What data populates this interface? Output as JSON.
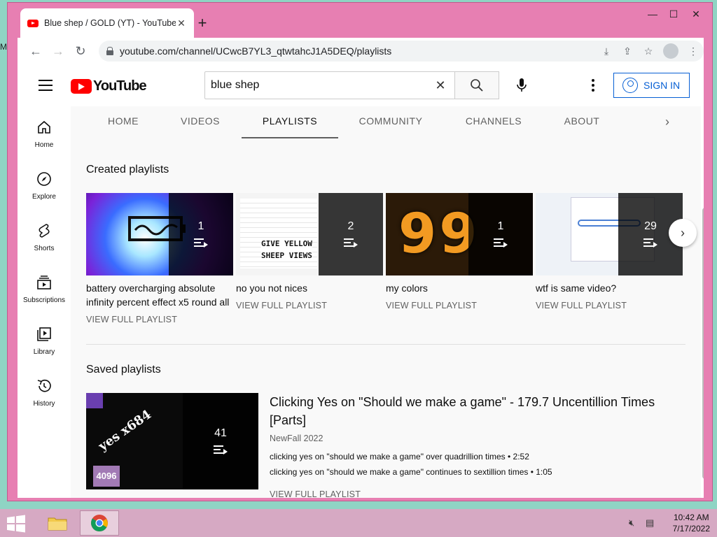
{
  "browser": {
    "tab_title": "Blue shep / GOLD (YT) - YouTube",
    "url": "youtube.com/channel/UCwcB7YL3_qtwtahcJ1A5DEQ/playlists"
  },
  "masthead": {
    "logo_text": "YouTube",
    "search_value": "blue shep",
    "sign_in_label": "SIGN IN"
  },
  "guide": {
    "items": [
      {
        "label": "Home",
        "icon": "home-icon"
      },
      {
        "label": "Explore",
        "icon": "compass-icon"
      },
      {
        "label": "Shorts",
        "icon": "shorts-icon"
      },
      {
        "label": "Subscriptions",
        "icon": "subscriptions-icon"
      },
      {
        "label": "Library",
        "icon": "library-icon"
      },
      {
        "label": "History",
        "icon": "history-icon"
      }
    ]
  },
  "channel_tabs": [
    "HOME",
    "VIDEOS",
    "PLAYLISTS",
    "COMMUNITY",
    "CHANNELS",
    "ABOUT"
  ],
  "active_tab": "PLAYLISTS",
  "created": {
    "heading": "Created playlists",
    "playlists": [
      {
        "title": "battery overcharging absolute infinity percent effect x5 round all",
        "count": "1",
        "link": "VIEW FULL PLAYLIST"
      },
      {
        "title": "no you not nices",
        "count": "2",
        "link": "VIEW FULL PLAYLIST",
        "thumb_text_1": "GIVE YELLOW",
        "thumb_text_2": "SHEEP VIEWS"
      },
      {
        "title": "my colors",
        "count": "1",
        "link": "VIEW FULL PLAYLIST",
        "thumb_text": "99"
      },
      {
        "title": "wtf is same video?",
        "count": "29",
        "link": "VIEW FULL PLAYLIST"
      }
    ]
  },
  "saved": {
    "heading": "Saved playlists",
    "playlist": {
      "title": "Clicking Yes on \"Should we make a game\" - 179.7 Uncentillion Times [Parts]",
      "owner": "NewFall 2022",
      "count": "41",
      "thumb_badge": "4096",
      "thumb_text": "yes x684",
      "videos": [
        "clicking yes on \"should we make a game\" over quadrillion times • 2:52",
        "clicking yes on \"should we make a game\" continues to sextillion times • 1:05"
      ],
      "link": "VIEW FULL PLAYLIST"
    }
  },
  "taskbar": {
    "time": "10:42 AM",
    "date": "7/17/2022"
  },
  "colors": {
    "window_frame": "#e77fb2",
    "desktop": "#8fd4c4",
    "taskbar": "#d6a9c3",
    "youtube_red": "#ff0000",
    "link_blue": "#065fd4"
  }
}
